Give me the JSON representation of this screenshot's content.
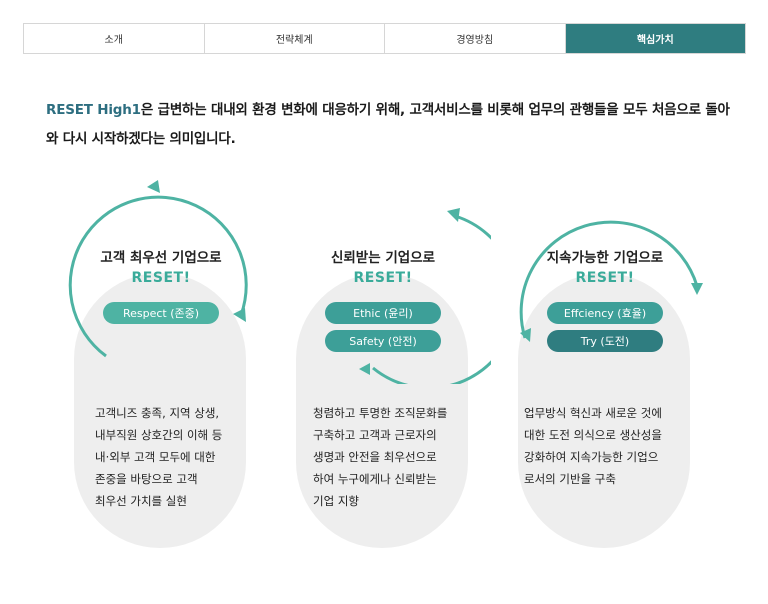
{
  "tabs": [
    {
      "label": "소개",
      "active": false
    },
    {
      "label": "전략체계",
      "active": false
    },
    {
      "label": "경영방침",
      "active": false
    },
    {
      "label": "핵심가치",
      "active": true
    }
  ],
  "intro": {
    "brand": "RESET High1",
    "text": "은 급변하는 대내외 환경 변화에 대응하기 위해, 고객서비스를 비롯해 업무의 관행들을 모두 처음으로 돌아와 다시 시작하겠다는 의미입니다."
  },
  "colors": {
    "accent": "#2f7d80",
    "ring": "#4eb3a3",
    "pill_bg": "#eeeeee"
  },
  "cards": [
    {
      "title": "고객 최우선 기업으로",
      "subtitle": "RESET!",
      "values": [
        "Respect (존중)"
      ],
      "desc": [
        "고객니즈 충족, 지역 상생,",
        "내부직원 상호간의 이해 등",
        "내·외부 고객 모두에 대한",
        "존중을 바탕으로 고객",
        "최우선 가치를 실현"
      ]
    },
    {
      "title": "신뢰받는 기업으로",
      "subtitle": "RESET!",
      "values": [
        "Ethic (윤리)",
        "Safety (안전)"
      ],
      "desc": [
        "청렴하고 투명한 조직문화를",
        "구축하고 고객과 근로자의",
        "생명과 안전을 최우선으로",
        "하여 누구에게나 신뢰받는",
        "기업 지향"
      ]
    },
    {
      "title": "지속가능한 기업으로",
      "subtitle": "RESET!",
      "values": [
        "Effciency (효율)",
        "Try (도전)"
      ],
      "desc": [
        "업무방식 혁신과 새로운 것에",
        "대한 도전 의식으로 생산성을",
        "강화하여 지속가능한 기업으",
        "로서의 기반을 구축"
      ]
    }
  ]
}
